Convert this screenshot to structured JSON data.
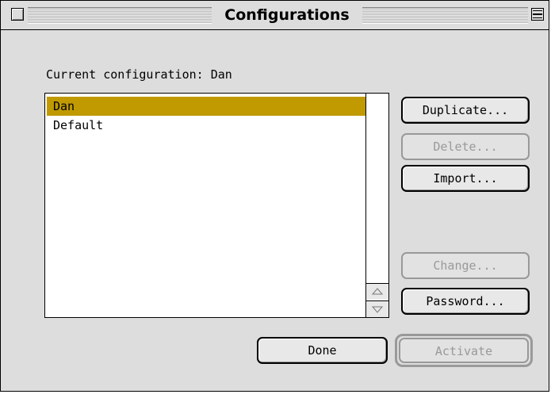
{
  "window": {
    "title": "Configurations"
  },
  "current_configuration": {
    "label": "Current configuration: Dan"
  },
  "list": {
    "items": [
      {
        "label": "Dan",
        "selected": true
      },
      {
        "label": "Default",
        "selected": false
      }
    ]
  },
  "buttons": {
    "duplicate": "Duplicate...",
    "delete": "Delete...",
    "import": "Import...",
    "change": "Change...",
    "password": "Password...",
    "done": "Done",
    "activate": "Activate"
  },
  "colors": {
    "selection": "#c09a00",
    "window_bg": "#dddddd",
    "disabled_text": "#999999"
  }
}
